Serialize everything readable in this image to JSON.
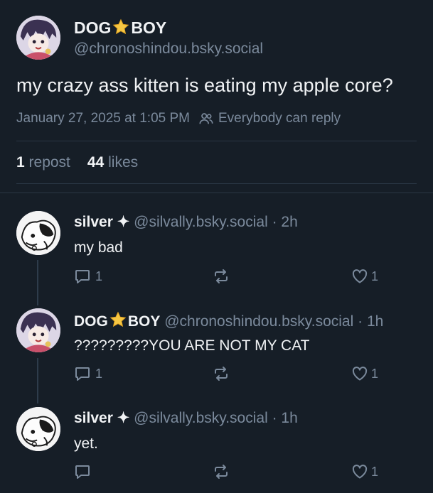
{
  "main_post": {
    "author_name_part1": "DOG",
    "author_name_part2": "BOY",
    "author_handle": "@chronoshindou.bsky.social",
    "text": "my crazy ass kitten is eating my apple core?",
    "timestamp": "January 27, 2025 at 1:05 PM",
    "reply_setting": "Everybody can reply",
    "reposts_count": "1",
    "reposts_label": "repost",
    "likes_count": "44",
    "likes_label": "likes"
  },
  "replies": [
    {
      "author_name": "silver ✦",
      "handle": "@silvally.bsky.social",
      "time": "· 2h",
      "text": "my bad",
      "reply_count": "1",
      "like_count": "1"
    },
    {
      "author_name_part1": "DOG",
      "author_name_part2": "BOY",
      "handle": "@chronoshindou.bsky.social",
      "time": "· 1h",
      "text": "?????????YOU ARE NOT MY CAT",
      "reply_count": "1",
      "like_count": "1"
    },
    {
      "author_name": "silver ✦",
      "handle": "@silvally.bsky.social",
      "time": "· 1h",
      "text": "yet.",
      "reply_count": "",
      "like_count": "1"
    }
  ],
  "icons": {
    "star": "star-emoji-icon",
    "people": "people-icon",
    "reply": "speech-bubble-icon",
    "repost": "repost-arrows-icon",
    "like": "heart-icon"
  },
  "colors": {
    "background": "#161e27",
    "text": "#f1f3f5",
    "muted": "#7b8a9c",
    "star": "#f6c744"
  }
}
